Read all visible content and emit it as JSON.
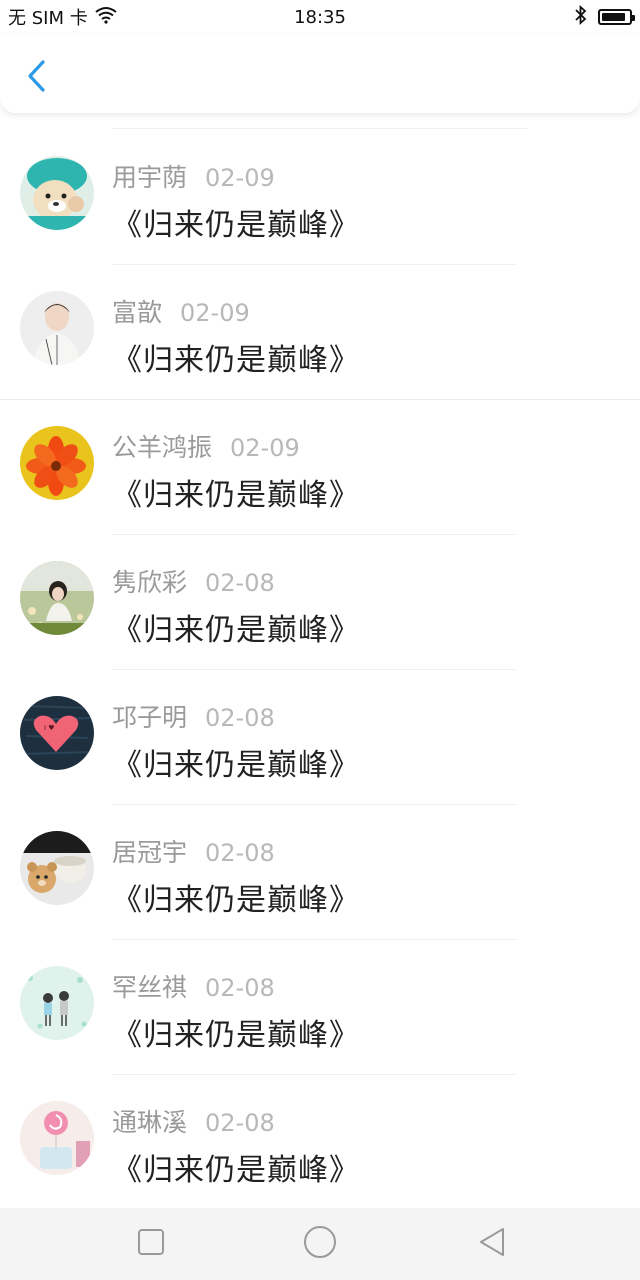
{
  "status_bar": {
    "carrier": "无 SIM 卡",
    "time": "18:35",
    "icons": [
      "wifi-icon",
      "bluetooth-icon",
      "battery-icon"
    ]
  },
  "header": {
    "back_icon": "chevron-left-icon",
    "accent_color": "#2b9be8"
  },
  "items": [
    {
      "name": "用宇荫",
      "date": "02-09",
      "title": "《归来仍是巅峰》",
      "avatar": "puppy-avatar"
    },
    {
      "name": "富歆",
      "date": "02-09",
      "title": "《归来仍是巅峰》",
      "avatar": "boy-avatar"
    },
    {
      "name": "公羊鸿振",
      "date": "02-09",
      "title": "《归来仍是巅峰》",
      "avatar": "flower-avatar"
    },
    {
      "name": "隽欣彩",
      "date": "02-08",
      "title": "《归来仍是巅峰》",
      "avatar": "girl-avatar"
    },
    {
      "name": "邛子明",
      "date": "02-08",
      "title": "《归来仍是巅峰》",
      "avatar": "heart-avatar"
    },
    {
      "name": "居冠宇",
      "date": "02-08",
      "title": "《归来仍是巅峰》",
      "avatar": "teddy-avatar"
    },
    {
      "name": "罕丝祺",
      "date": "02-08",
      "title": "《归来仍是巅峰》",
      "avatar": "couple-avatar"
    },
    {
      "name": "通琳溪",
      "date": "02-08",
      "title": "《归来仍是巅峰》",
      "avatar": "lollipop-avatar"
    }
  ],
  "nav_bar": {
    "buttons": [
      "recent-apps-icon",
      "home-icon",
      "back-triangle-icon"
    ]
  }
}
